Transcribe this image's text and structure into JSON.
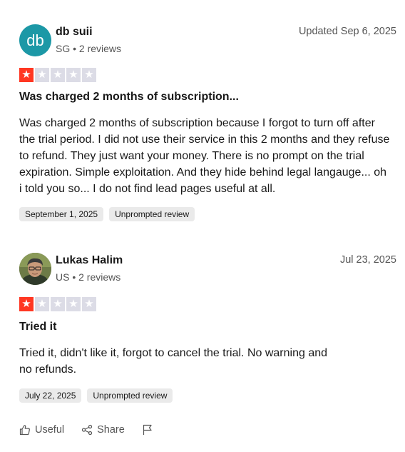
{
  "reviews": [
    {
      "avatar_initials": "db",
      "avatar_color": "#1c98a6",
      "name": "db suii",
      "meta": "SG • 2 reviews",
      "date": "Updated Sep 6, 2025",
      "rating": 1,
      "max_rating": 5,
      "title": "Was charged 2 months of subscription...",
      "body": "Was charged 2 months of subscription because I forgot to turn off after the trial period. I did not use their service in this 2 months and they refuse to refund. They just want your money. There is no prompt on the trial expiration. Simple exploitation. And they hide behind legal langauge... oh i told you so... I do not find lead pages useful at all.",
      "tags": [
        "September 1, 2025",
        "Unprompted review"
      ]
    },
    {
      "avatar_icon": "user-photo",
      "name": "Lukas Halim",
      "meta": "US • 2 reviews",
      "date": "Jul 23, 2025",
      "rating": 1,
      "max_rating": 5,
      "title": "Tried it",
      "body_lines": [
        "Tried it, didn't like it, forgot to cancel the trial. No warning and",
        "no refunds."
      ],
      "tags": [
        "July 22, 2025",
        "Unprompted review"
      ]
    }
  ],
  "actions": {
    "useful_label": "Useful",
    "share_label": "Share",
    "useful_icon": "thumbs-up-icon",
    "share_icon": "share-icon",
    "flag_icon": "flag-icon"
  },
  "colors": {
    "star_filled": "#ff3722",
    "star_empty": "#dcdce6",
    "tag_bg": "#eaeaea"
  }
}
